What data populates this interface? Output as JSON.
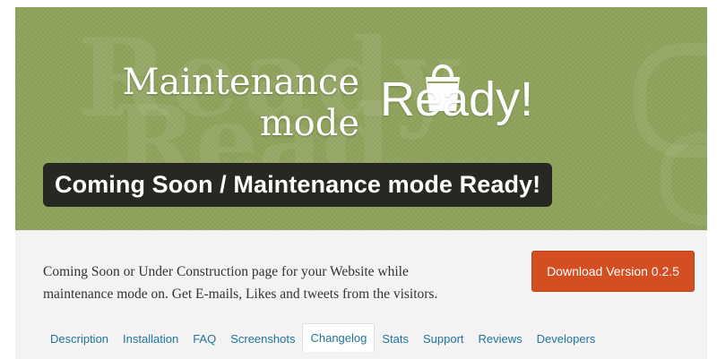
{
  "banner": {
    "logo_line1": "Maintenance",
    "logo_line2": "mode",
    "ready_text": "Ready!",
    "headline": "Coming Soon / Maintenance mode Ready!",
    "watermark_line1": "Ready",
    "watermark_line2": "Read",
    "colors": {
      "background": "#8fa35c",
      "headline_box": "#1e1e1e"
    }
  },
  "plugin": {
    "description_line1": "Coming Soon or Under Construction page for your Website while",
    "description_line2": "maintenance mode on. Get E-mails, Likes and tweets from the visitors.",
    "download_label": "Download Version 0.2.5",
    "download_color": "#d54e21"
  },
  "tabs": [
    {
      "label": "Description",
      "active": false
    },
    {
      "label": "Installation",
      "active": false
    },
    {
      "label": "FAQ",
      "active": false
    },
    {
      "label": "Screenshots",
      "active": false
    },
    {
      "label": "Changelog",
      "active": true
    },
    {
      "label": "Stats",
      "active": false
    },
    {
      "label": "Support",
      "active": false
    },
    {
      "label": "Reviews",
      "active": false
    },
    {
      "label": "Developers",
      "active": false
    }
  ],
  "icons": {
    "logo_bag": "shopping-bag-icon"
  },
  "link_color": "#21759b"
}
